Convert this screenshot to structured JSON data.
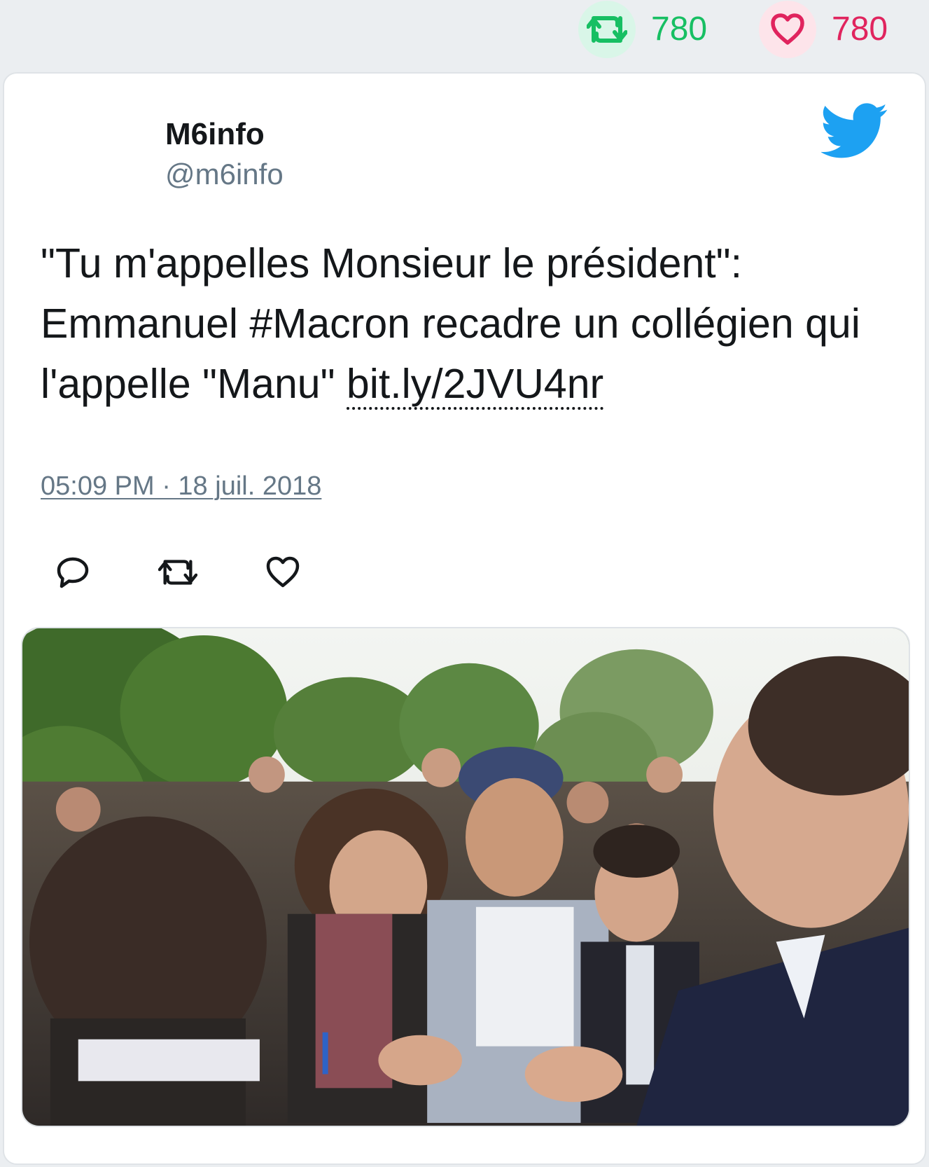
{
  "stats": {
    "retweet_count": "780",
    "retweet_icon": "retweet-icon",
    "like_count": "780",
    "like_icon": "heart-icon"
  },
  "tweet": {
    "author_name": "M6info",
    "author_handle": "@m6info",
    "text": "\"Tu m'appelles Monsieur le président\": Emmanuel #Macron recadre un collégien qui l'appelle \"Manu\" ",
    "link_text": "bit.ly/2JVU4nr",
    "timestamp": "05:09 PM · 18 juil. 2018",
    "brand_icon": "twitter-bird-icon"
  },
  "actions": {
    "reply_icon": "reply-icon",
    "retweet_icon": "retweet-icon",
    "like_icon": "heart-icon"
  },
  "colors": {
    "twitter_blue": "#1da1f2",
    "retweet_green": "#17bf63",
    "like_red": "#e0245e",
    "text_dark": "#14171a",
    "text_muted": "#657786",
    "page_bg": "#ebeef1"
  }
}
